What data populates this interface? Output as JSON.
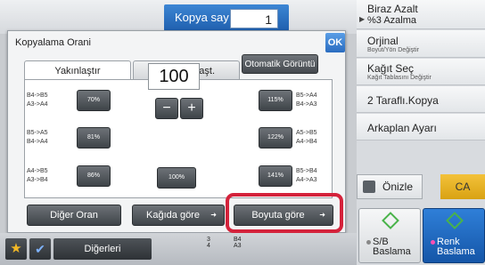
{
  "header": {
    "copies_label": "Kopya sayısı",
    "copies_value": "1"
  },
  "right_panel": {
    "items": [
      {
        "main": "Biraz Azalt",
        "sub": "%3 Azalma"
      },
      {
        "main": "Orjinal",
        "sub": "Boyut/Yön Değiştir"
      },
      {
        "main": "Kağıt Seç",
        "sub": "Kağıt Tablasını Değiştir"
      },
      {
        "main": "2 Taraflı.Kopya",
        "sub": ""
      },
      {
        "main": "Arkaplan Ayarı",
        "sub": ""
      }
    ],
    "preview_label": "Önizle",
    "ca_label": "CA",
    "start_bw_label": "S/B\nBaslama",
    "start_color_label": "Renk\nBaslama"
  },
  "dialog": {
    "title": "Kopyalama Orani",
    "ok_label": "OK",
    "tabs": [
      "Yakınlaştır",
      "XY yakınlaşt."
    ],
    "auto_label": "Otomatik Görüntü",
    "presets_left": [
      {
        "label": "B4->B5\nA3->A4",
        "value": "70%"
      },
      {
        "label": "B5->A5\nB4->A4",
        "value": "81%"
      },
      {
        "label": "A4->B5\nA3->B4",
        "value": "86%"
      }
    ],
    "presets_right": [
      {
        "label": "B5->A4\nB4->A3",
        "value": "115%"
      },
      {
        "label": "A5->B5\nA4->B4",
        "value": "122%"
      },
      {
        "label": "B5->B4\nA4->A3",
        "value": "141%"
      }
    ],
    "ratio_value": "100",
    "minus": "−",
    "plus": "+",
    "reset_label": "100%",
    "buttons": {
      "other": "Diğer Oran",
      "paper": "Kağıda göre",
      "size": "Boyuta göre"
    }
  },
  "bottom": {
    "others_label": "Diğerleri",
    "mini_rows": [
      {
        "a": "3",
        "b": "B4"
      },
      {
        "a": "4",
        "b": "A3"
      }
    ]
  }
}
